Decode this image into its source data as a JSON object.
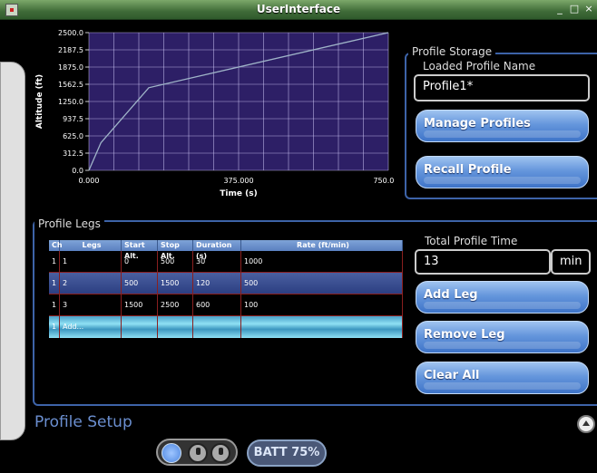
{
  "window": {
    "title": "UserInterface",
    "minimize": "_",
    "maximize": "□",
    "close": "×"
  },
  "chart_data": {
    "type": "line",
    "xlabel": "Time (s)",
    "ylabel": "Altitude (ft)",
    "xticks": [
      "0.000",
      "375.000",
      "750.000"
    ],
    "yticks": [
      "0.0",
      "312.5",
      "625.0",
      "937.5",
      "1250.0",
      "1562.5",
      "1875.0",
      "2187.5",
      "2500.0"
    ],
    "xlim": [
      0,
      750
    ],
    "ylim": [
      0,
      2500
    ],
    "x": [
      0,
      30,
      150,
      750
    ],
    "y": [
      0,
      500,
      1500,
      2500
    ],
    "plot_bg": "#2d1f66",
    "grid_color": "#d7d0ff",
    "line_color": "#9fb4c8",
    "grid": true
  },
  "storage": {
    "group_title": "Profile Storage",
    "loaded_label": "Loaded Profile Name",
    "loaded_value": "Profile1*",
    "manage_label": "Manage Profiles",
    "recall_label": "Recall Profile"
  },
  "legs": {
    "group_title": "Profile Legs",
    "columns": [
      "Ch",
      "Legs",
      "Start Alt.",
      "Stop Alt.",
      "Duration (s)",
      "Rate (ft/min)"
    ],
    "rows": [
      [
        "1",
        "1",
        "0",
        "500",
        "30",
        "1000"
      ],
      [
        "1",
        "2",
        "500",
        "1500",
        "120",
        "500"
      ],
      [
        "1",
        "3",
        "1500",
        "2500",
        "600",
        "100"
      ]
    ],
    "add_row": [
      "1",
      "Add..."
    ],
    "total_label": "Total Profile Time",
    "total_value": "13",
    "total_unit": "min",
    "add_leg": "Add Leg",
    "remove_leg": "Remove Leg",
    "clear_all": "Clear All"
  },
  "footer": {
    "title": "Profile Setup",
    "battery": "BATT 75%"
  }
}
